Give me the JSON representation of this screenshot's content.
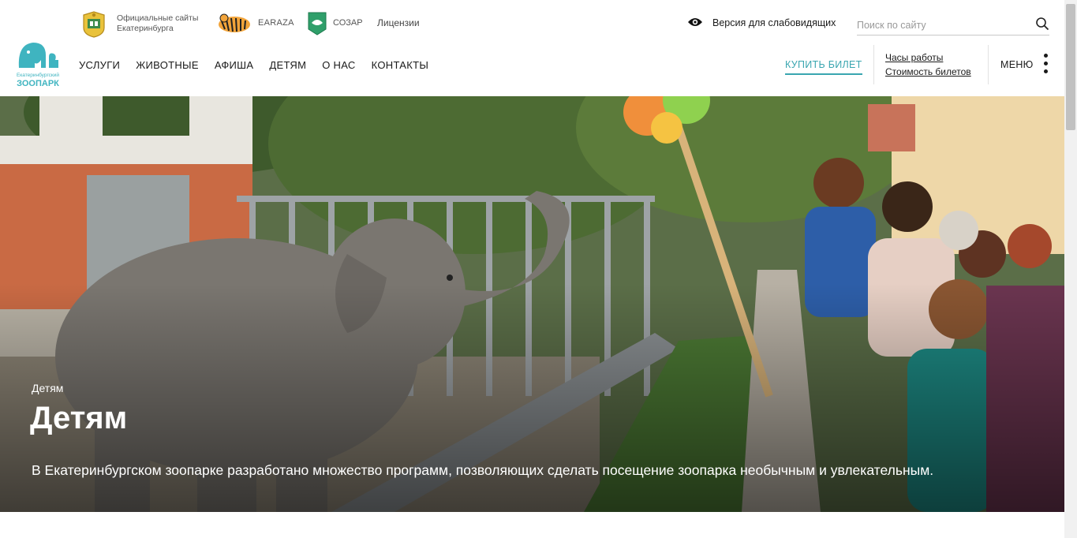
{
  "topbar": {
    "city_sites_text": "Официальные сайты Екатеринбурга",
    "earaza_text": "EARAZA",
    "sozar_text": "СОЗАР",
    "licenses_text": "Лицензии",
    "vision_text": "Версия для слабовидящих",
    "search_placeholder": "Поиск по сайту"
  },
  "logo": {
    "small_text": "Екатеринбургский",
    "big_text": "ЗООПАРК",
    "color": "#3fb4c0"
  },
  "nav": {
    "items": [
      "УСЛУГИ",
      "ЖИВОТНЫЕ",
      "АФИША",
      "ДЕТЯМ",
      "О НАС",
      "КОНТАКТЫ"
    ]
  },
  "header_right": {
    "buy_ticket": "КУПИТЬ БИЛЕТ",
    "hours": "Часы работы",
    "prices": "Стоимость билетов",
    "menu": "МЕНЮ"
  },
  "hero": {
    "breadcrumb": "Детям",
    "title": "Детям",
    "description": "В Екатеринбургском зоопарке разработано множество программ, позволяющих сделать посещение зоопарка необычным и увлекательным."
  },
  "colors": {
    "accent": "#3aa6b0",
    "text": "#1a1a1a"
  }
}
